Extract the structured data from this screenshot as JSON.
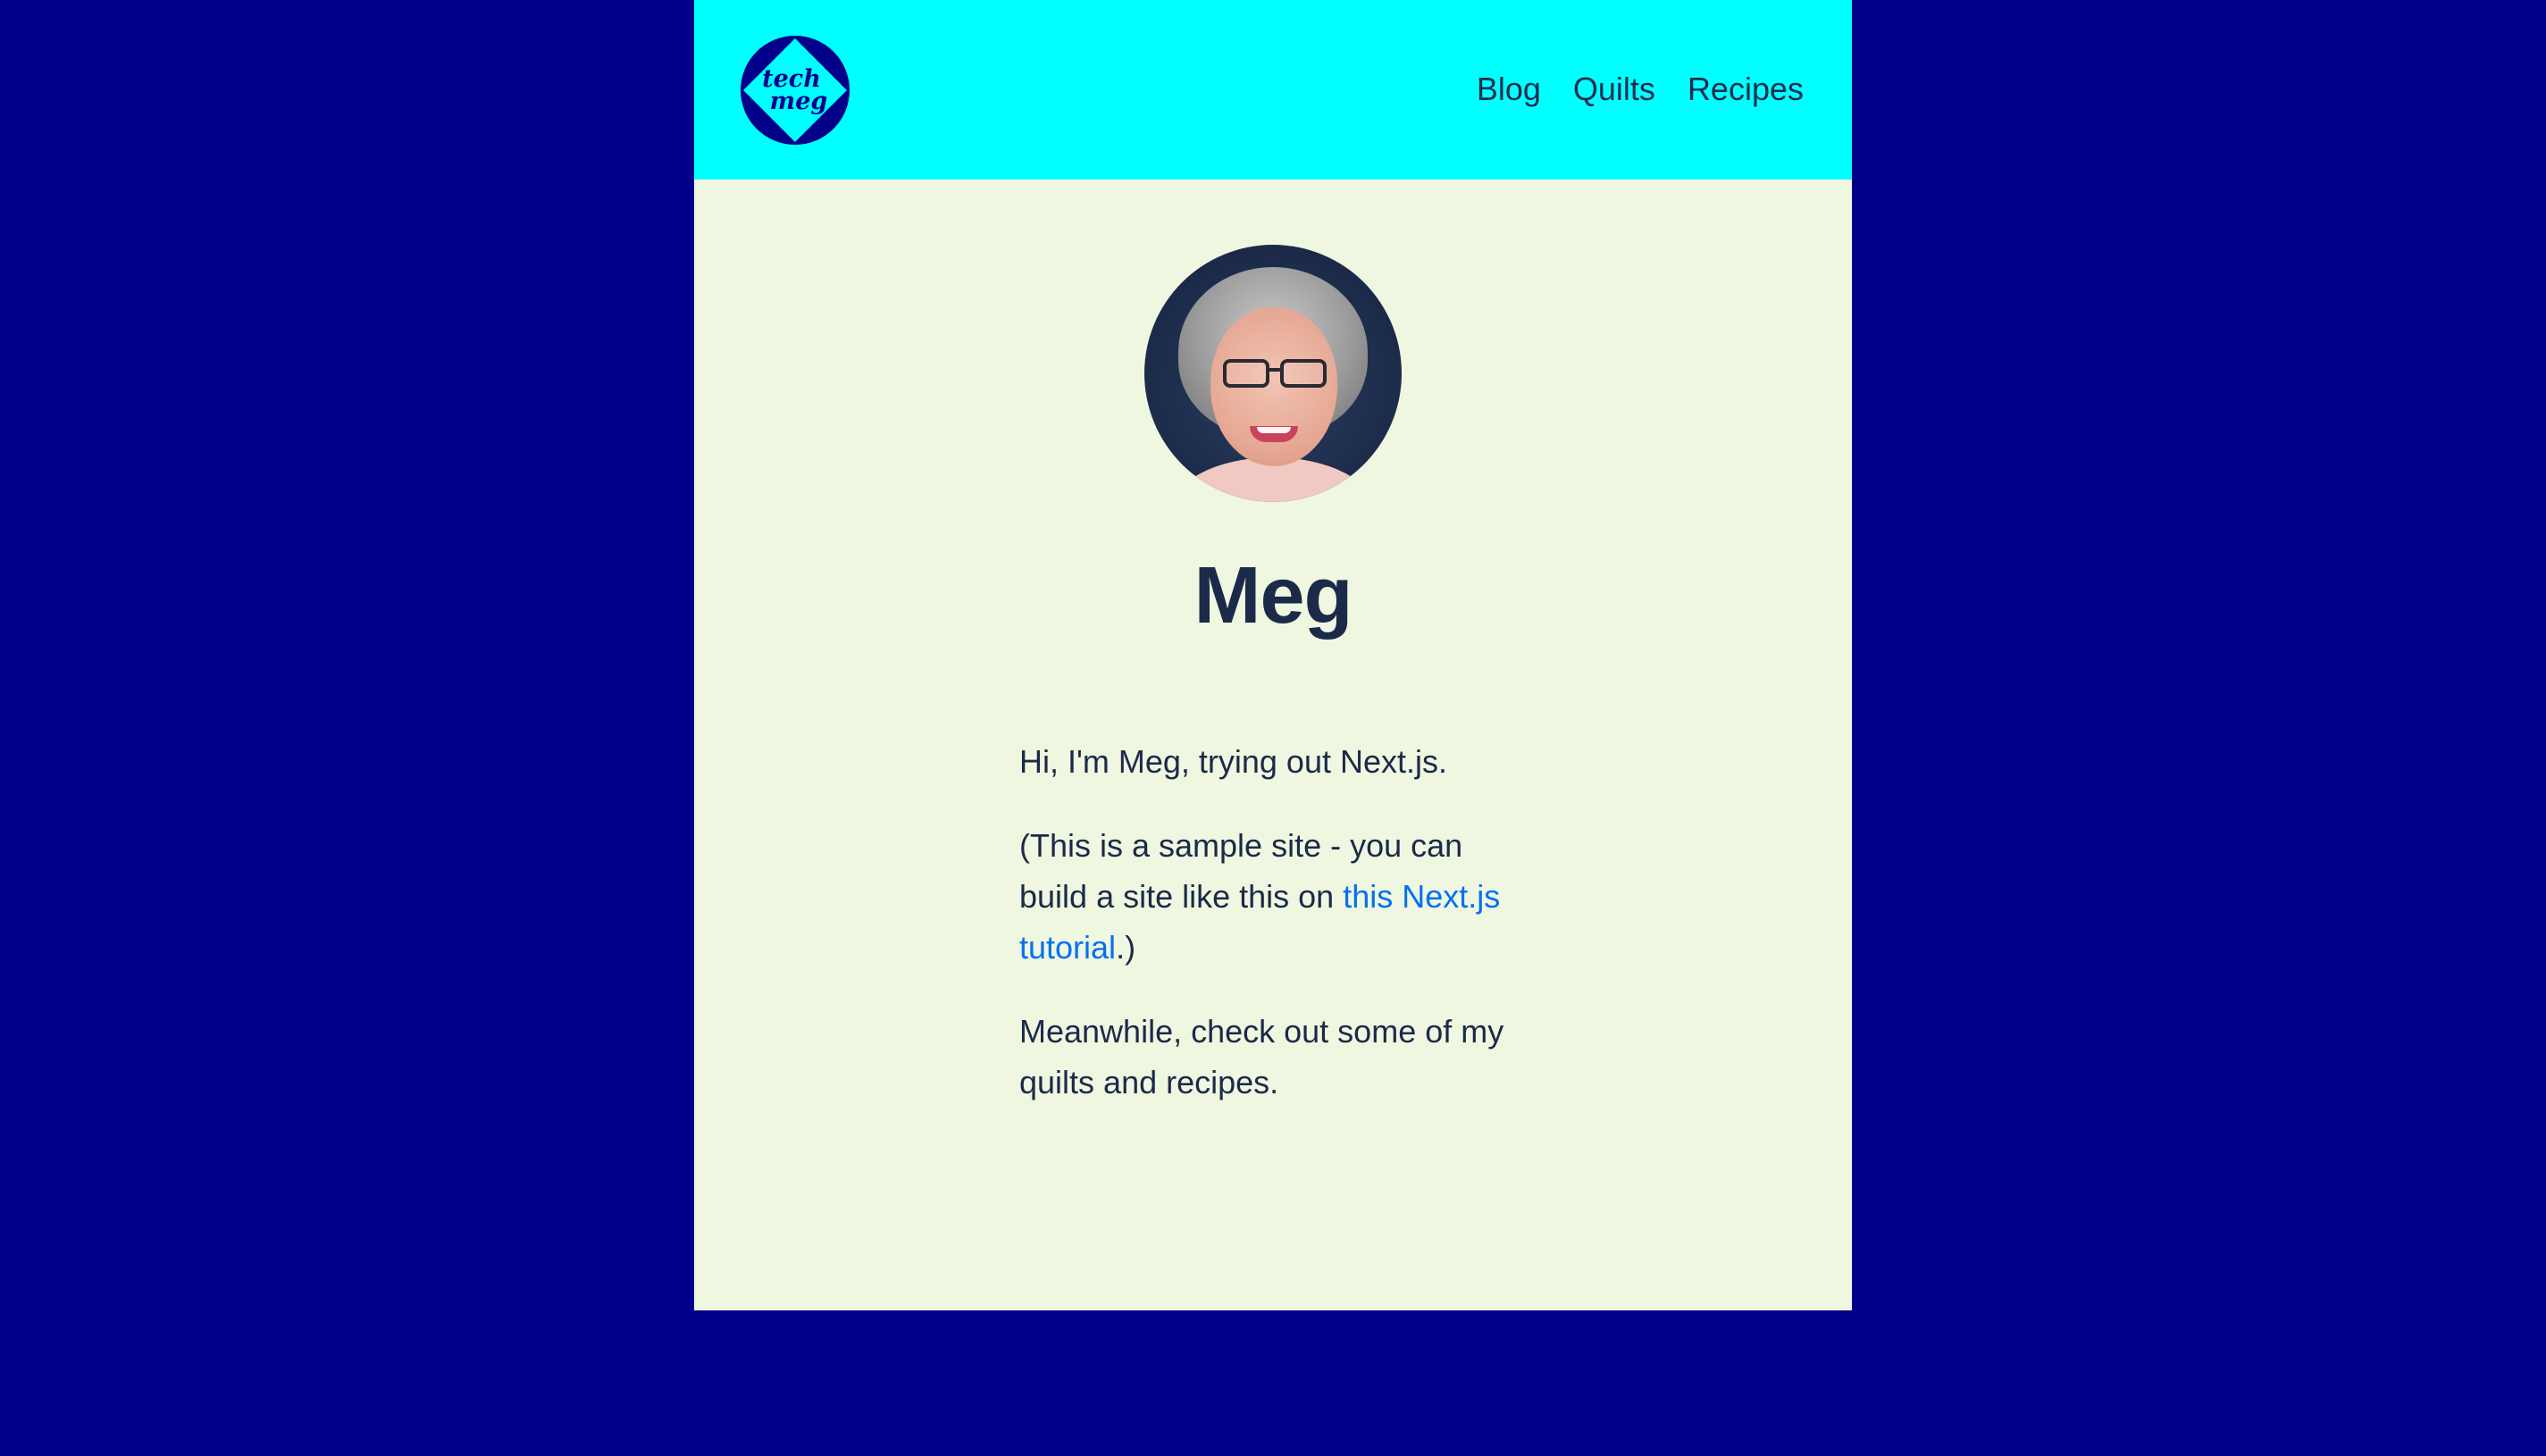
{
  "header": {
    "logo": {
      "line1": "tech",
      "line2": "meg"
    },
    "nav": [
      "Blog",
      "Quilts",
      "Recipes"
    ]
  },
  "profile": {
    "name": "Meg"
  },
  "content": {
    "intro": "Hi, I'm Meg, trying out Next.js.",
    "sample_prefix": "(This is a sample site - you can build a site like this on ",
    "tutorial_link": "this Next.js tutorial",
    "sample_suffix": ".)",
    "meanwhile": "Meanwhile, check out some of my quilts and recipes."
  },
  "colors": {
    "background": "#00008b",
    "header": "#00ffff",
    "page": "#eff7e0",
    "text": "#1b2a49",
    "link": "#0070f3"
  }
}
